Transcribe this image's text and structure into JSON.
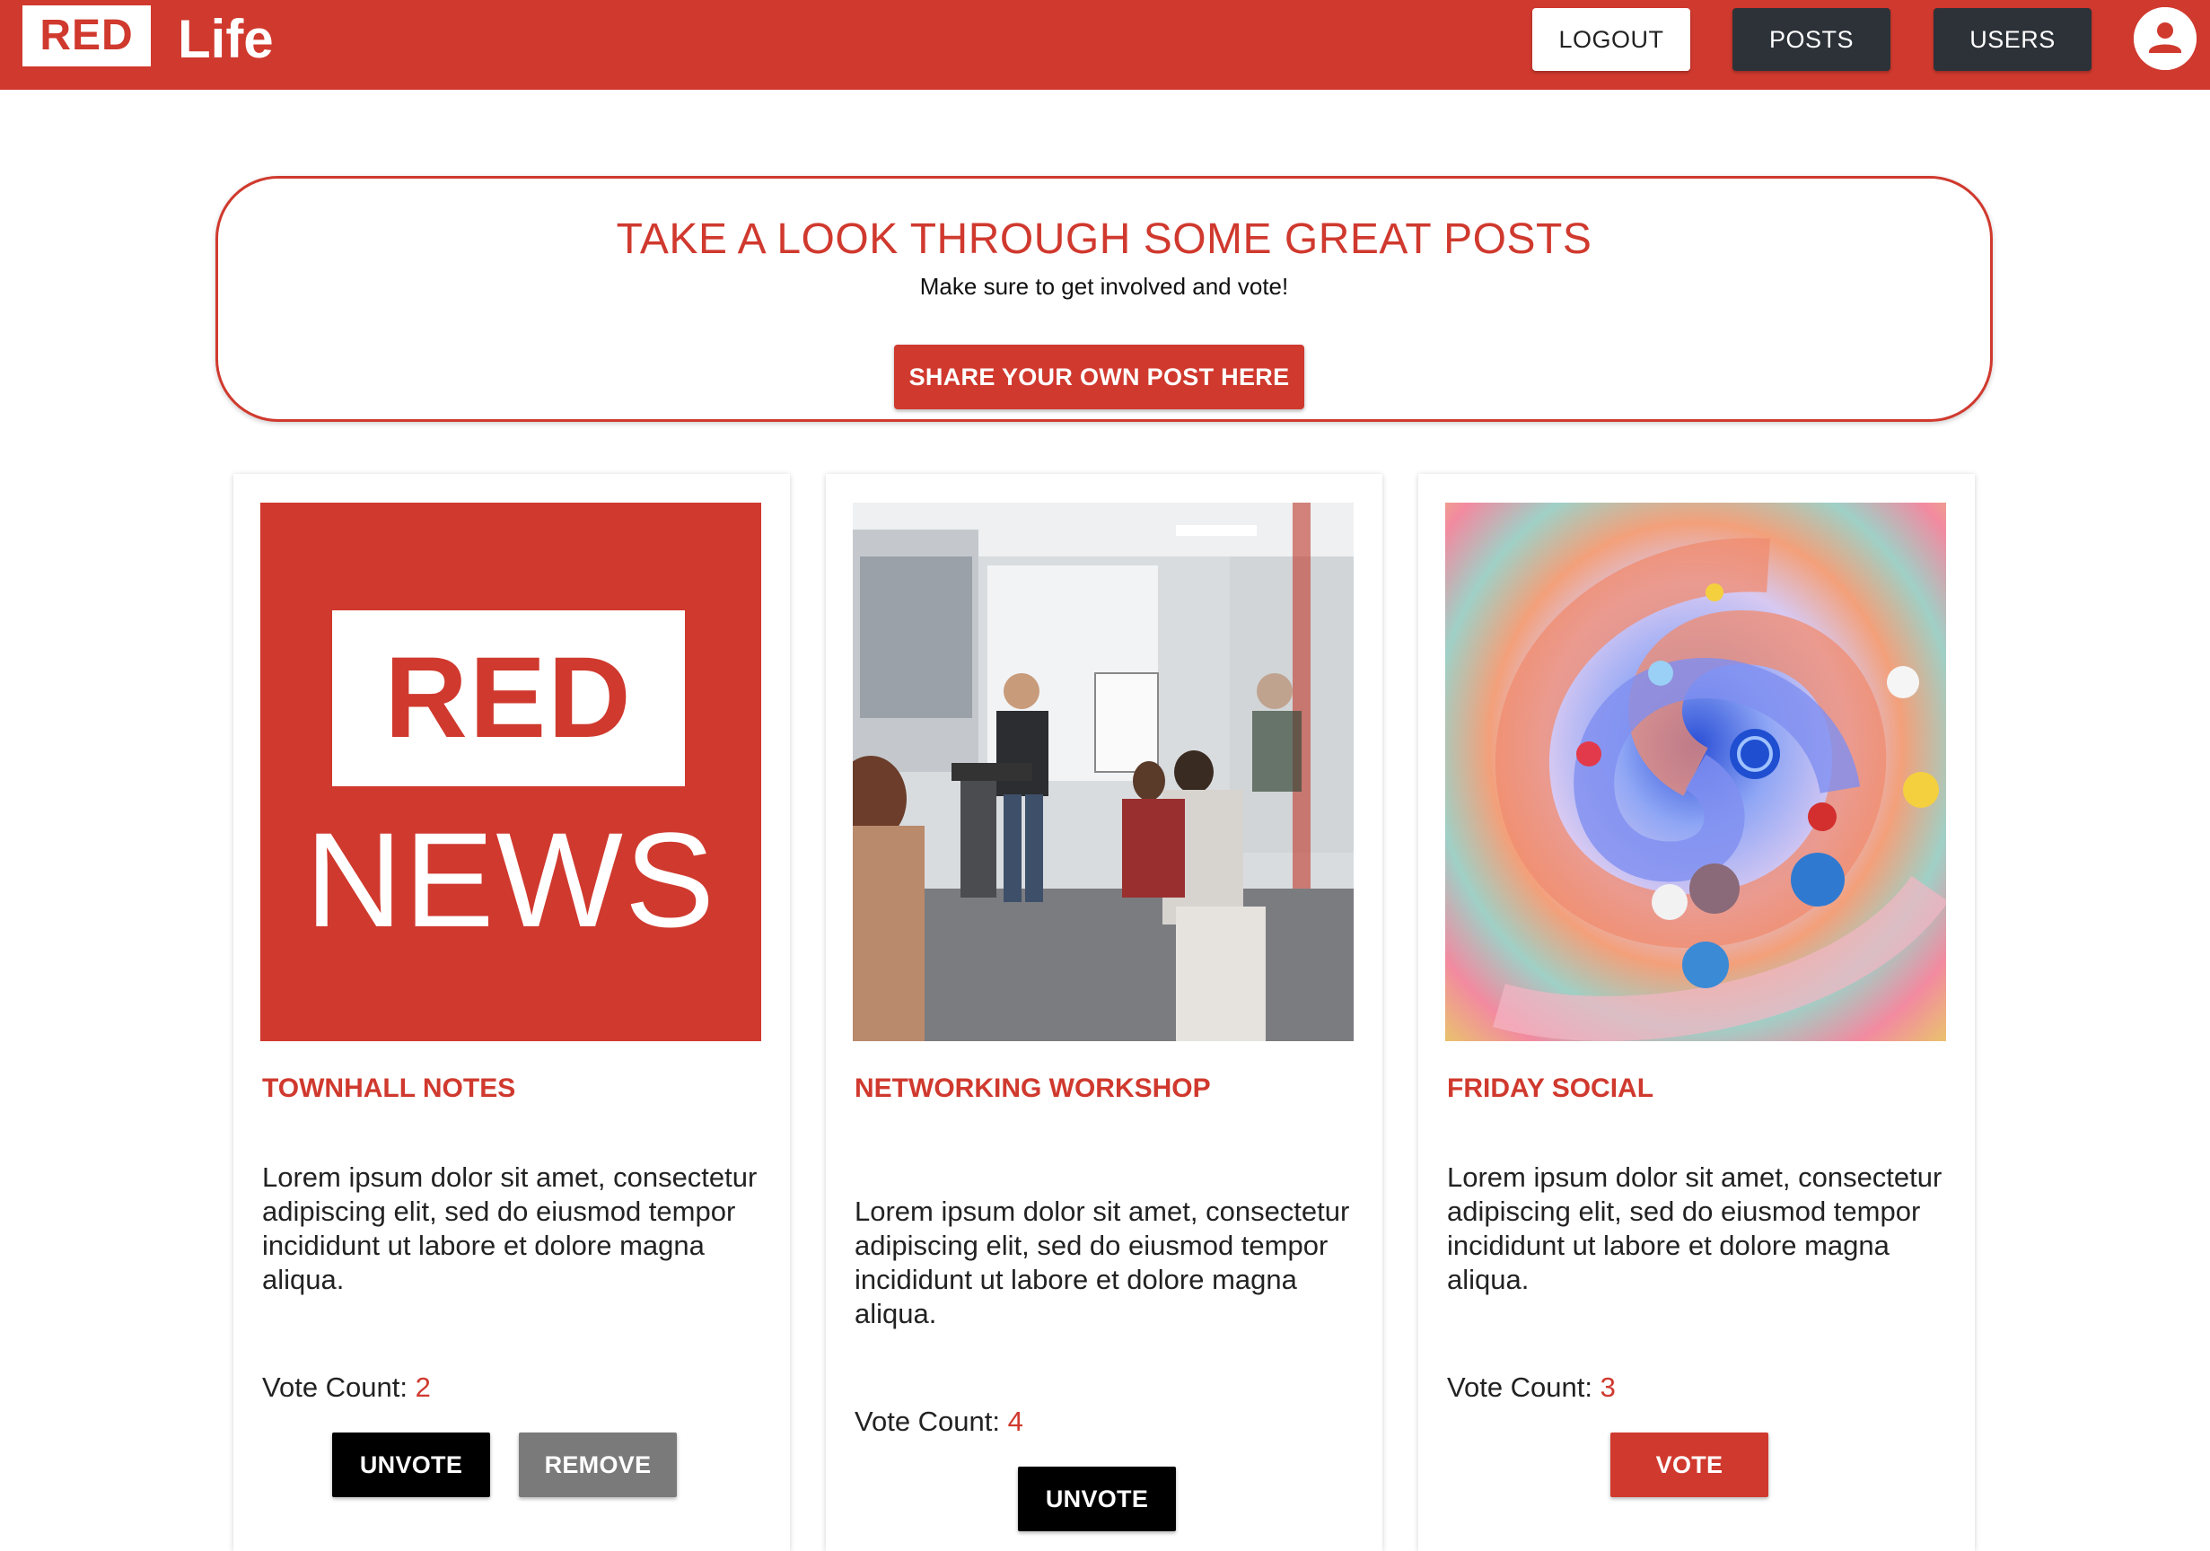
{
  "header": {
    "logo_red": "RED",
    "logo_life": "Life",
    "logout_label": "LOGOUT",
    "posts_label": "POSTS",
    "users_label": "USERS",
    "brand_color": "#d0392e"
  },
  "hero": {
    "title": "TAKE A LOOK THROUGH SOME GREAT POSTS",
    "subtitle": "Make sure to get involved and vote!",
    "cta_label": "SHARE YOUR OWN POST HERE"
  },
  "posts": [
    {
      "title": "TOWNHALL NOTES",
      "image": {
        "logo_red": "RED",
        "logo_news": "NEWS"
      },
      "body": "Lorem ipsum dolor sit amet, consectetur adipiscing elit, sed do eiusmod tempor incididunt ut labore et dolore magna aliqua.",
      "vote_label": "Vote Count:",
      "vote_count": "2",
      "buttons": [
        "UNVOTE",
        "REMOVE"
      ]
    },
    {
      "title": "NETWORKING WORKSHOP",
      "body": "Lorem ipsum dolor sit amet, consectetur adipiscing elit, sed do eiusmod tempor incididunt ut labore et dolore magna aliqua.",
      "vote_label": "Vote Count:",
      "vote_count": "4",
      "buttons": [
        "UNVOTE"
      ]
    },
    {
      "title": "FRIDAY SOCIAL",
      "body": "Lorem ipsum dolor sit amet, consectetur adipiscing elit, sed do eiusmod tempor incididunt ut labore et dolore magna aliqua.",
      "vote_label": "Vote Count:",
      "vote_count": "3",
      "buttons": [
        "VOTE"
      ]
    }
  ]
}
